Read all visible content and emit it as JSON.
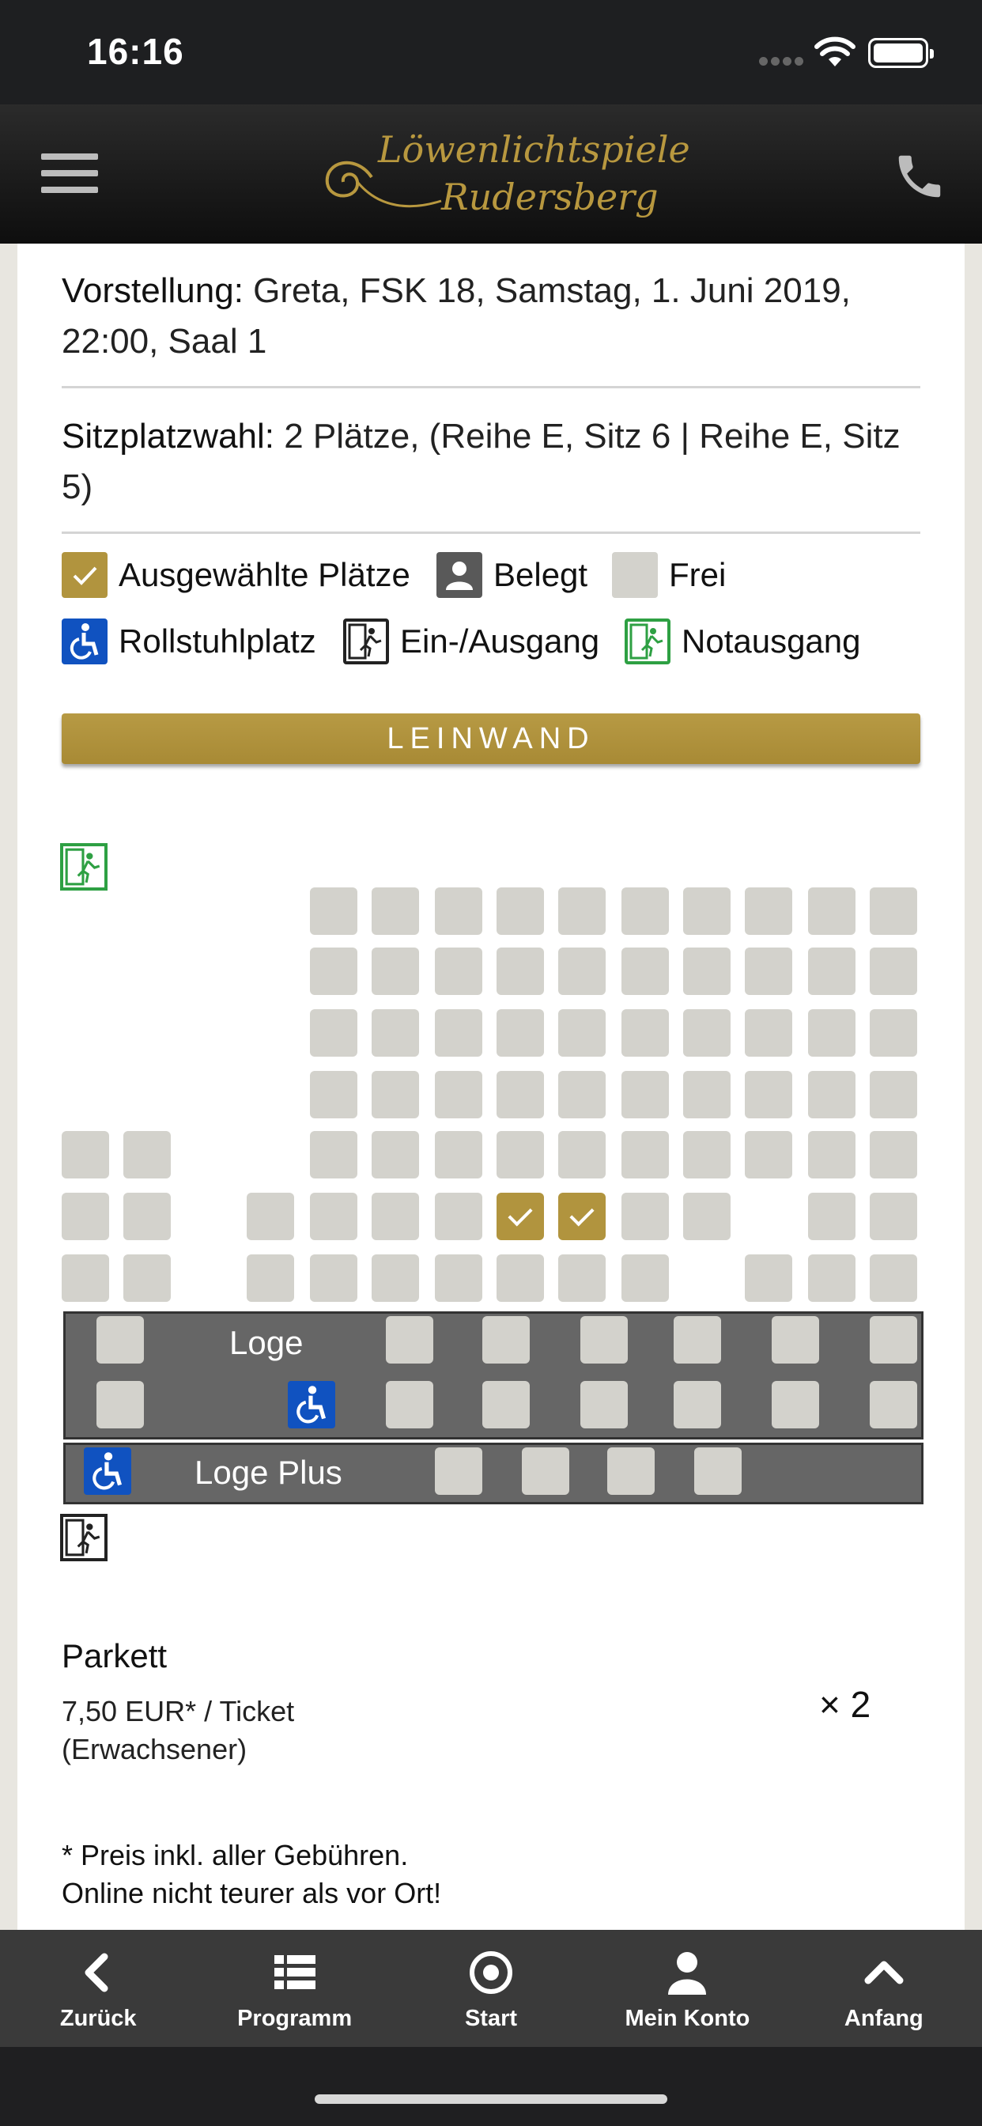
{
  "status_bar": {
    "time": "16:16"
  },
  "header": {
    "logo_line1": "Löwenlichtspiele",
    "logo_line2": "Rudersberg"
  },
  "booking": {
    "show_label": "Vorstellung:",
    "show_value": " Greta, FSK 18, Samstag, 1. Juni 2019, 22:00, Saal 1",
    "seats_label": "Sitzplatzwahl:",
    "seats_value": " 2 Plätze, (Reihe E, Sitz 6 | Reihe E, Sitz 5)"
  },
  "legend": {
    "selected": "Ausgewählte Plätze",
    "occupied": "Belegt",
    "free": "Frei",
    "wheelchair": "Rollstuhlplatz",
    "entrance": "Ein-/Ausgang",
    "emergency": "Notausgang"
  },
  "screen_label": "LEINWAND",
  "seatmap": {
    "loge_label": "Loge",
    "loge_plus_label": "Loge Plus",
    "selected_seats": [
      "Reihe E, Sitz 6",
      "Reihe E, Sitz 5"
    ]
  },
  "pricing": {
    "category": "Parkett",
    "price_line1": "7,50 EUR* / Ticket",
    "price_line2": "(Erwachsener)",
    "quantity": "× 2",
    "note_line1": "* Preis inkl. aller Gebühren.",
    "note_line2": "Online nicht teurer als vor Ort!"
  },
  "bottom_nav": [
    {
      "label": "Zurück",
      "icon": "chevron-left-icon"
    },
    {
      "label": "Programm",
      "icon": "list-icon"
    },
    {
      "label": "Start",
      "icon": "target-icon"
    },
    {
      "label": "Mein Konto",
      "icon": "user-icon"
    },
    {
      "label": "Anfang",
      "icon": "chevron-up-icon"
    }
  ],
  "colors": {
    "gold": "#b1943e",
    "free_seat": "#d3d2cc",
    "wheelchair": "#1052c0",
    "emergency": "#2ea043",
    "nav_bg": "#3a3a3a"
  }
}
